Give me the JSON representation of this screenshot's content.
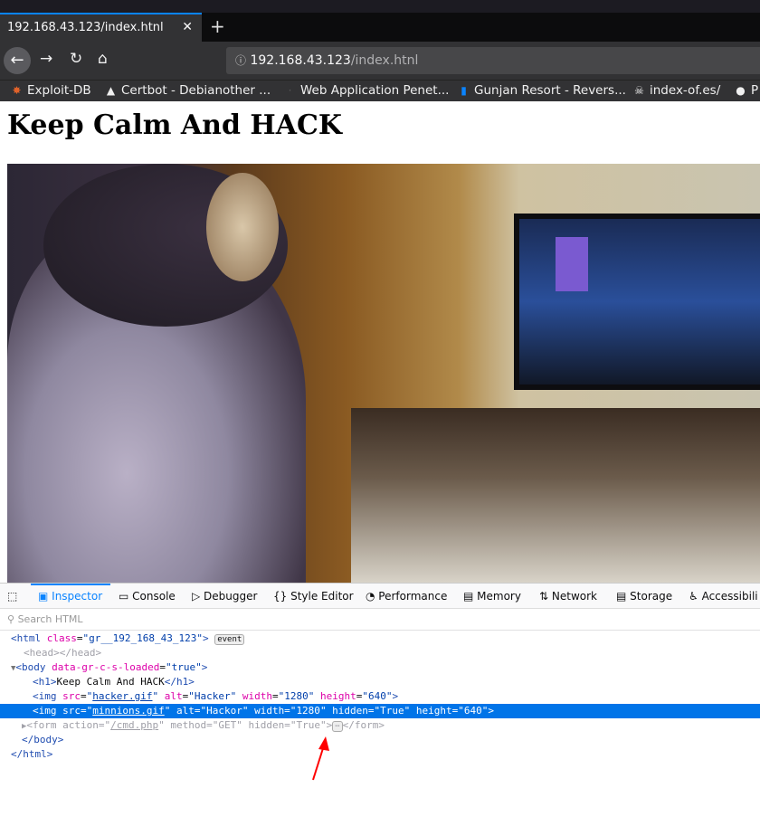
{
  "browser": {
    "tab_title": "192.168.43.123/index.htnl",
    "url_host": "192.168.43.123",
    "url_path": "/index.htnl",
    "bookmarks": [
      "Exploit-DB",
      "Certbot - Debianother ...",
      "Web Application Penet...",
      "Gunjan Resort - Revers...",
      "index-of.es/",
      "P"
    ]
  },
  "page": {
    "heading": "Keep Calm And HACK",
    "image_alt": "Hacker"
  },
  "devtools": {
    "tabs": [
      "Inspector",
      "Console",
      "Debugger",
      "Style Editor",
      "Performance",
      "Memory",
      "Network",
      "Storage",
      "Accessibili"
    ],
    "search_placeholder": "Search HTML",
    "accent": "#0a84ff",
    "selection_color": "#0074e8",
    "tree": {
      "html_class": "gr__192_168_43_123",
      "event_badge": "event",
      "head": "<head></head>",
      "body_attr": "data-gr-c-s-loaded",
      "body_val": "true",
      "h1_text": "Keep Calm And HACK",
      "img1": {
        "src": "hacker.gif",
        "alt": "Hacker",
        "width": "1280",
        "height": "640"
      },
      "img2": {
        "src": "minnions.gif",
        "alt": "Hackor",
        "width": "1280",
        "hidden": "True",
        "height": "640"
      },
      "form": {
        "action": "/cmd.php",
        "method": "GET",
        "hidden": "True"
      }
    }
  }
}
